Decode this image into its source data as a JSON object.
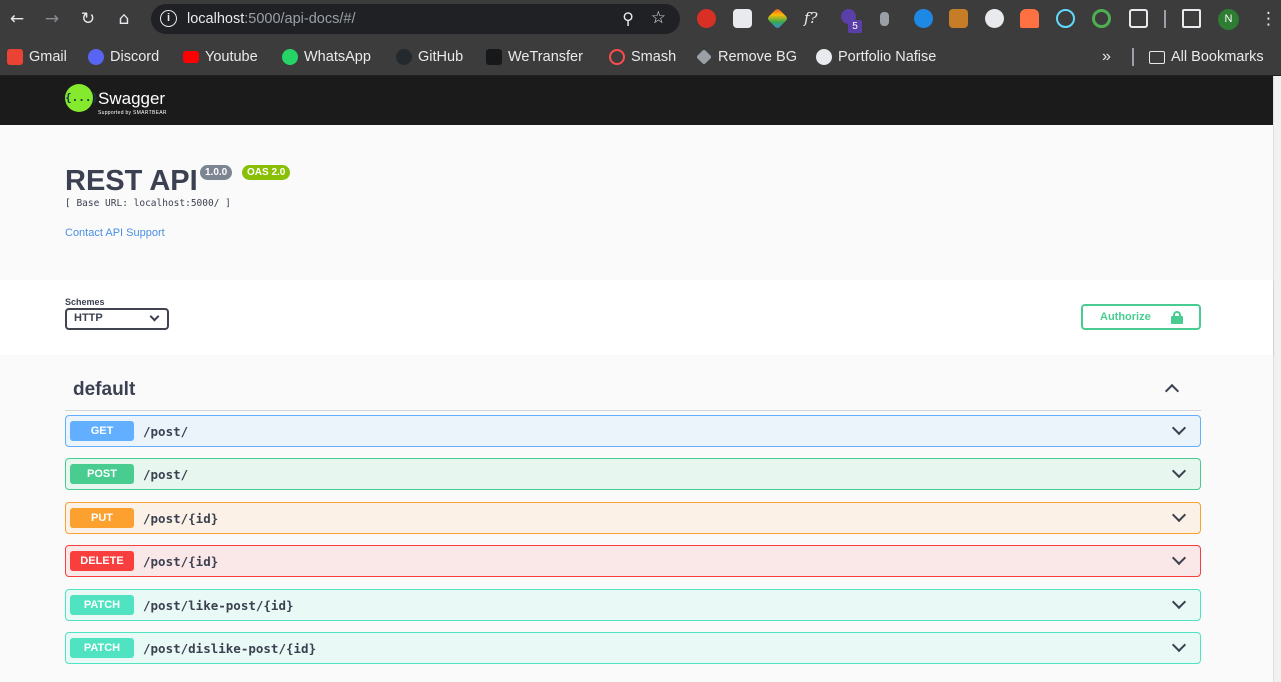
{
  "browser": {
    "url_host": "localhost",
    "url_rest": ":5000/api-docs/#/",
    "extension_badge": "5",
    "profile_initial": "N"
  },
  "bookmarks": {
    "items": [
      {
        "label": "Gmail",
        "color": "#ea4335"
      },
      {
        "label": "Discord",
        "color": "#5865f2"
      },
      {
        "label": "Youtube",
        "color": "#ff0000"
      },
      {
        "label": "WhatsApp",
        "color": "#25d366"
      },
      {
        "label": "GitHub",
        "color": "#24292e"
      },
      {
        "label": "WeTransfer",
        "color": "#17181a"
      },
      {
        "label": "Smash",
        "color": "#ff4b4b"
      },
      {
        "label": "Remove BG",
        "color": "#9aa0a6"
      },
      {
        "label": "Portfolio Nafise",
        "color": "#e8eaed"
      }
    ],
    "more": "»",
    "all_bookmarks": "All Bookmarks"
  },
  "swagger": {
    "logo_text": "Swagger",
    "logo_glyph": "{...}",
    "logo_sub": "Supported by SMARTBEAR"
  },
  "info": {
    "title": "REST API",
    "version": "1.0.0",
    "oas": "OAS 2.0",
    "base_url": "[ Base URL: localhost:5000/ ]",
    "contact": "Contact API Support"
  },
  "schemes": {
    "label": "Schemes",
    "selected": "HTTP",
    "authorize_label": "Authorize"
  },
  "tag": {
    "name": "default",
    "operations": [
      {
        "method": "GET",
        "path": "/post/"
      },
      {
        "method": "POST",
        "path": "/post/"
      },
      {
        "method": "PUT",
        "path": "/post/{id}"
      },
      {
        "method": "DELETE",
        "path": "/post/{id}"
      },
      {
        "method": "PATCH",
        "path": "/post/like-post/{id}"
      },
      {
        "method": "PATCH",
        "path": "/post/dislike-post/{id}"
      }
    ]
  },
  "colors": {
    "get": "#61affe",
    "post": "#49cc90",
    "put": "#fca130",
    "delete": "#f93e3e",
    "patch": "#50e3c2",
    "swagger_green": "#85ea2d"
  }
}
